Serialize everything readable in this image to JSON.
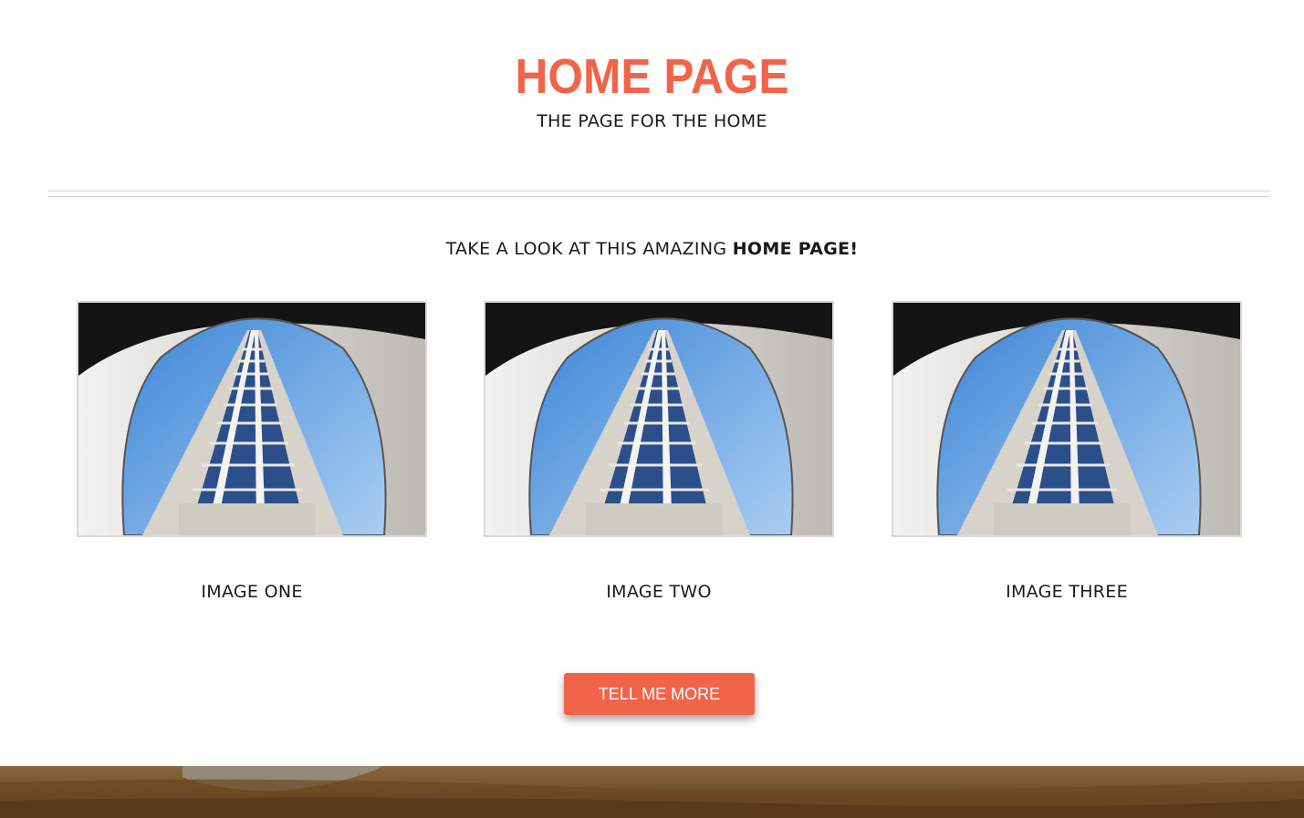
{
  "header": {
    "title": "HOME PAGE",
    "subtitle": "THE PAGE FOR THE HOME"
  },
  "intro": {
    "text": "TAKE A LOOK AT THIS AMAZING ",
    "emphasis": "HOME PAGE!"
  },
  "gallery": {
    "items": [
      {
        "caption": "IMAGE ONE",
        "image": "skyscraper-photo"
      },
      {
        "caption": "IMAGE TWO",
        "image": "skyscraper-photo"
      },
      {
        "caption": "IMAGE THREE",
        "image": "skyscraper-photo"
      }
    ]
  },
  "cta": {
    "label": "TELL ME MORE"
  },
  "footer": {
    "image": "landscape-photo"
  },
  "colors": {
    "accent": "#f2644a",
    "text": "#1a1a1a",
    "divider": "#d6d6d6"
  }
}
